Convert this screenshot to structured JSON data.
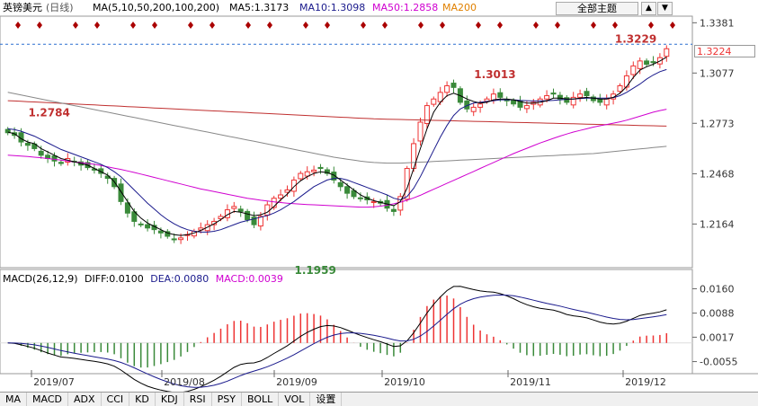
{
  "header": {
    "symbol": "英镑美元",
    "period": "(日线)",
    "ma_label": "MA(5,10,50,200,100,200)",
    "ma5": "MA5:1.3173",
    "ma10": "MA10:1.3098",
    "ma50": "MA50:1.2858",
    "ma200": "MA200",
    "theme_button": "全部主题",
    "nav_up": "▲",
    "nav_down": "▼"
  },
  "macd_legend": {
    "title": "MACD(26,12,9)",
    "diff": "DIFF:0.0100",
    "dea": "DEA:0.0080",
    "macd": "MACD:0.0039"
  },
  "price_tag": "1.3224",
  "bottom_tabs": [
    "MA",
    "MACD",
    "ADX",
    "CCI",
    "KD",
    "KDJ",
    "RSI",
    "PSY",
    "BOLL",
    "VOL",
    "设置"
  ],
  "colors": {
    "up": "#e33",
    "down": "#3a8a3a",
    "ma5": "#000000",
    "ma10": "#1a1a8c",
    "ma50": "#d000d0",
    "ma100": "#888888",
    "ma200": "#c03030",
    "grid": "#cccccc"
  },
  "chart_data": {
    "type": "candlestick",
    "price_axis": {
      "ticks": [
        1.3381,
        1.3077,
        1.2773,
        1.2468,
        1.2164
      ],
      "ylim": [
        1.19,
        1.341
      ]
    },
    "macd_axis": {
      "ticks": [
        0.016,
        0.0088,
        0.0017,
        -0.0055
      ],
      "ylim": [
        -0.008,
        0.0185
      ]
    },
    "x_labels": [
      "2019/07",
      "2019/08",
      "2019/09",
      "2019/10",
      "2019/11",
      "2019/12"
    ],
    "annotations": [
      {
        "text": "1.2784",
        "value": 1.2784
      },
      {
        "text": "1.1959",
        "value": 1.1959
      },
      {
        "text": "1.3013",
        "value": 1.3013
      },
      {
        "text": "1.3229",
        "value": 1.3229
      }
    ],
    "current_price": 1.3224,
    "close": [
      1.2716,
      1.27,
      1.266,
      1.264,
      1.262,
      1.258,
      1.256,
      1.2545,
      1.253,
      1.256,
      1.254,
      1.252,
      1.2505,
      1.249,
      1.247,
      1.244,
      1.239,
      1.23,
      1.223,
      1.218,
      1.216,
      1.214,
      1.213,
      1.211,
      1.209,
      1.207,
      1.208,
      1.21,
      1.212,
      1.214,
      1.216,
      1.218,
      1.221,
      1.225,
      1.227,
      1.224,
      1.219,
      1.216,
      1.221,
      1.228,
      1.232,
      1.234,
      1.237,
      1.243,
      1.247,
      1.248,
      1.249,
      1.25,
      1.247,
      1.243,
      1.239,
      1.235,
      1.233,
      1.232,
      1.231,
      1.23,
      1.229,
      1.226,
      1.224,
      1.233,
      1.25,
      1.265,
      1.278,
      1.288,
      1.292,
      1.296,
      1.3,
      1.299,
      1.29,
      1.286,
      1.287,
      1.289,
      1.292,
      1.295,
      1.293,
      1.291,
      1.289,
      1.287,
      1.288,
      1.29,
      1.292,
      1.294,
      1.295,
      1.292,
      1.29,
      1.293,
      1.295,
      1.294,
      1.291,
      1.29,
      1.292,
      1.295,
      1.3,
      1.306,
      1.312,
      1.315,
      1.313,
      1.314,
      1.317,
      1.3224
    ],
    "ma5": [
      1.272,
      1.271,
      1.268,
      1.266,
      1.265,
      1.262,
      1.26,
      1.258,
      1.256,
      1.255,
      1.254,
      1.253,
      1.252,
      1.25,
      1.248,
      1.246,
      1.242,
      1.236,
      1.23,
      1.224,
      1.22,
      1.217,
      1.215,
      1.213,
      1.211,
      1.21,
      1.2095,
      1.21,
      1.211,
      1.2125,
      1.2145,
      1.2165,
      1.219,
      1.222,
      1.224,
      1.2235,
      1.2225,
      1.2215,
      1.222,
      1.2235,
      1.227,
      1.231,
      1.2345,
      1.239,
      1.2425,
      1.245,
      1.247,
      1.248,
      1.2475,
      1.246,
      1.243,
      1.24,
      1.237,
      1.234,
      1.232,
      1.2305,
      1.2295,
      1.2285,
      1.2275,
      1.23,
      1.238,
      1.25,
      1.262,
      1.274,
      1.284,
      1.29,
      1.294,
      1.2955,
      1.294,
      1.292,
      1.2905,
      1.2895,
      1.29,
      1.2915,
      1.292,
      1.292,
      1.2915,
      1.2905,
      1.2895,
      1.2895,
      1.29,
      1.291,
      1.2925,
      1.2925,
      1.292,
      1.292,
      1.2925,
      1.293,
      1.2925,
      1.292,
      1.292,
      1.293,
      1.2955,
      1.2995,
      1.305,
      1.3095,
      1.3115,
      1.313,
      1.315,
      1.3173
    ],
    "ma10": [
      1.274,
      1.2735,
      1.2725,
      1.271,
      1.2695,
      1.2675,
      1.2655,
      1.2635,
      1.2615,
      1.26,
      1.2585,
      1.257,
      1.2555,
      1.254,
      1.2525,
      1.2505,
      1.248,
      1.245,
      1.241,
      1.237,
      1.233,
      1.229,
      1.2255,
      1.222,
      1.219,
      1.2165,
      1.2145,
      1.213,
      1.212,
      1.2115,
      1.2115,
      1.212,
      1.213,
      1.2145,
      1.216,
      1.2175,
      1.2185,
      1.2195,
      1.2205,
      1.2215,
      1.223,
      1.225,
      1.2275,
      1.23,
      1.233,
      1.236,
      1.239,
      1.241,
      1.243,
      1.244,
      1.244,
      1.243,
      1.2415,
      1.24,
      1.2385,
      1.237,
      1.2355,
      1.234,
      1.232,
      1.231,
      1.233,
      1.238,
      1.245,
      1.253,
      1.261,
      1.269,
      1.276,
      1.282,
      1.286,
      1.288,
      1.2895,
      1.29,
      1.2905,
      1.291,
      1.2915,
      1.2915,
      1.2915,
      1.2912,
      1.291,
      1.2908,
      1.2908,
      1.291,
      1.2912,
      1.2915,
      1.2918,
      1.292,
      1.2922,
      1.2925,
      1.2925,
      1.2925,
      1.2925,
      1.2928,
      1.294,
      1.296,
      1.2985,
      1.301,
      1.304,
      1.3065,
      1.3085,
      1.3098
    ],
    "ma50": [
      1.258,
      1.2578,
      1.2575,
      1.2572,
      1.2568,
      1.2565,
      1.256,
      1.2555,
      1.255,
      1.2545,
      1.254,
      1.2535,
      1.253,
      1.2525,
      1.2518,
      1.251,
      1.2502,
      1.2494,
      1.2485,
      1.2476,
      1.2466,
      1.2456,
      1.2446,
      1.2436,
      1.2426,
      1.2416,
      1.2406,
      1.2396,
      1.2386,
      1.2376,
      1.2368,
      1.236,
      1.2352,
      1.2344,
      1.2336,
      1.2328,
      1.232,
      1.2314,
      1.2308,
      1.2303,
      1.2298,
      1.2294,
      1.229,
      1.2287,
      1.2284,
      1.2282,
      1.228,
      1.2278,
      1.2276,
      1.2274,
      1.2272,
      1.227,
      1.2268,
      1.2266,
      1.2266,
      1.2268,
      1.2272,
      1.2278,
      1.2286,
      1.2296,
      1.2308,
      1.2322,
      1.2338,
      1.2356,
      1.2374,
      1.2392,
      1.241,
      1.2428,
      1.2446,
      1.2464,
      1.2482,
      1.25,
      1.2518,
      1.2536,
      1.2554,
      1.2572,
      1.259,
      1.2606,
      1.2622,
      1.2638,
      1.2654,
      1.2668,
      1.2682,
      1.2696,
      1.2708,
      1.272,
      1.273,
      1.274,
      1.275,
      1.2758,
      1.2766,
      1.2774,
      1.2782,
      1.2792,
      1.2804,
      1.2816,
      1.2828,
      1.284,
      1.285,
      1.2858
    ],
    "ma100": [
      1.296,
      1.2952,
      1.2944,
      1.2936,
      1.2928,
      1.292,
      1.2912,
      1.2904,
      1.2896,
      1.2888,
      1.288,
      1.2872,
      1.2864,
      1.2856,
      1.2848,
      1.284,
      1.2832,
      1.2824,
      1.2816,
      1.2808,
      1.28,
      1.2792,
      1.2784,
      1.2776,
      1.2768,
      1.276,
      1.2752,
      1.2744,
      1.2736,
      1.2728,
      1.272,
      1.2712,
      1.2704,
      1.2696,
      1.2688,
      1.268,
      1.2672,
      1.2664,
      1.2656,
      1.2648,
      1.264,
      1.2632,
      1.2624,
      1.2616,
      1.2608,
      1.26,
      1.2592,
      1.2584,
      1.2576,
      1.2568,
      1.2562,
      1.2556,
      1.255,
      1.2544,
      1.254,
      1.2536,
      1.2534,
      1.2532,
      1.2532,
      1.2532,
      1.2534,
      1.2536,
      1.2538,
      1.254,
      1.2542,
      1.2544,
      1.2546,
      1.2548,
      1.255,
      1.2552,
      1.2554,
      1.2556,
      1.2558,
      1.256,
      1.2562,
      1.2564,
      1.2566,
      1.2568,
      1.257,
      1.2572,
      1.2574,
      1.2576,
      1.2578,
      1.258,
      1.2582,
      1.2584,
      1.2586,
      1.2588,
      1.259,
      1.2594,
      1.2598,
      1.2602,
      1.2606,
      1.261,
      1.2614,
      1.2618,
      1.2622,
      1.2626,
      1.263,
      1.2634
    ],
    "ma200": [
      1.291,
      1.2908,
      1.2906,
      1.2904,
      1.2902,
      1.29,
      1.2898,
      1.2896,
      1.2894,
      1.2892,
      1.289,
      1.2888,
      1.2886,
      1.2884,
      1.2882,
      1.288,
      1.2878,
      1.2876,
      1.2874,
      1.2872,
      1.287,
      1.2868,
      1.2866,
      1.2864,
      1.2862,
      1.286,
      1.2858,
      1.2856,
      1.2854,
      1.2852,
      1.285,
      1.2848,
      1.2846,
      1.2844,
      1.2842,
      1.284,
      1.2838,
      1.2836,
      1.2834,
      1.2832,
      1.283,
      1.2828,
      1.2826,
      1.2824,
      1.2822,
      1.282,
      1.2818,
      1.2816,
      1.2814,
      1.2812,
      1.281,
      1.2808,
      1.2806,
      1.2804,
      1.2802,
      1.28,
      1.2799,
      1.2798,
      1.2797,
      1.2796,
      1.2795,
      1.2794,
      1.2793,
      1.2792,
      1.2791,
      1.279,
      1.2789,
      1.2788,
      1.2787,
      1.2786,
      1.2785,
      1.2784,
      1.2783,
      1.2782,
      1.2781,
      1.278,
      1.2779,
      1.2778,
      1.2777,
      1.2776,
      1.2775,
      1.2774,
      1.2773,
      1.2772,
      1.2771,
      1.277,
      1.2769,
      1.2768,
      1.2767,
      1.2766,
      1.2765,
      1.2764,
      1.2763,
      1.2762,
      1.2761,
      1.276,
      1.2759,
      1.2758,
      1.2757,
      1.2756
    ]
  }
}
